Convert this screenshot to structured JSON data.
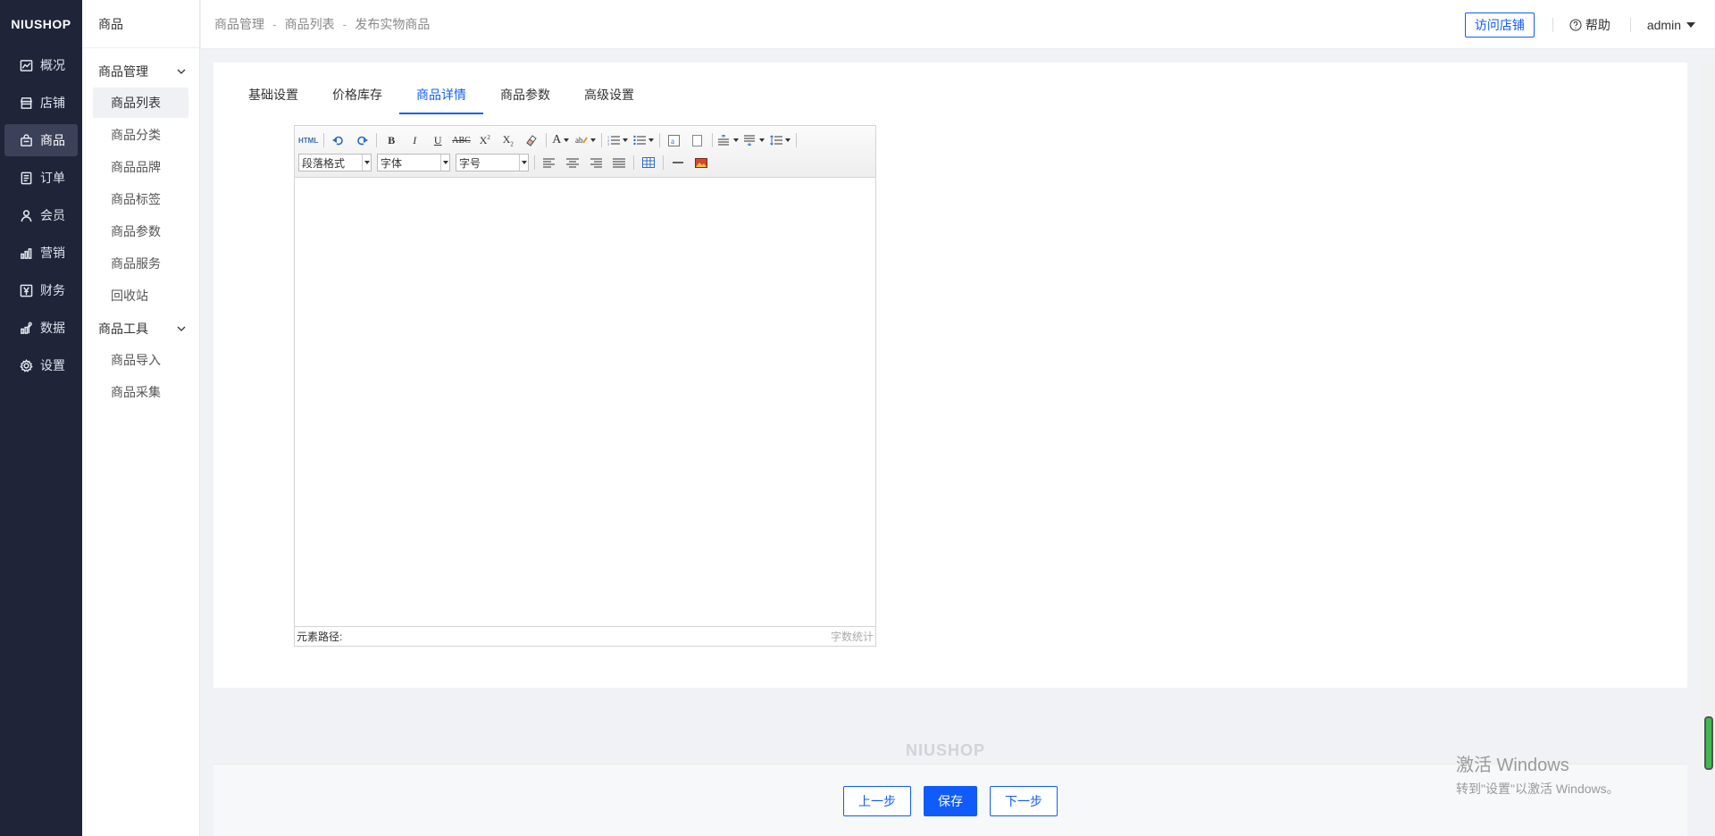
{
  "brand": "NIUSHOP",
  "main_nav": [
    {
      "label": "概况",
      "icon": "chart-line-icon",
      "active": false
    },
    {
      "label": "店铺",
      "icon": "store-icon",
      "active": false
    },
    {
      "label": "商品",
      "icon": "bag-icon",
      "active": true
    },
    {
      "label": "订单",
      "icon": "order-icon",
      "active": false
    },
    {
      "label": "会员",
      "icon": "user-icon",
      "active": false
    },
    {
      "label": "营销",
      "icon": "bar-chart-icon",
      "active": false
    },
    {
      "label": "财务",
      "icon": "yen-icon",
      "active": false
    },
    {
      "label": "数据",
      "icon": "data-icon",
      "active": false
    },
    {
      "label": "设置",
      "icon": "gear-icon",
      "active": false
    }
  ],
  "sub_nav": {
    "title": "商品",
    "groups": [
      {
        "label": "商品管理",
        "items": [
          "商品列表",
          "商品分类",
          "商品品牌",
          "商品标签",
          "商品参数",
          "商品服务",
          "回收站"
        ]
      },
      {
        "label": "商品工具",
        "items": [
          "商品导入",
          "商品采集"
        ]
      }
    ],
    "active_item": "商品列表"
  },
  "header": {
    "breadcrumb": [
      "商品管理",
      "商品列表",
      "发布实物商品"
    ],
    "separator": "-",
    "visit_store": "访问店铺",
    "help": "帮助",
    "user": "admin"
  },
  "tabs": [
    "基础设置",
    "价格库存",
    "商品详情",
    "商品参数",
    "高级设置"
  ],
  "active_tab": "商品详情",
  "editor": {
    "html_label": "HTML",
    "paragraph_select": "段落格式",
    "font_select": "字体",
    "size_select": "字号",
    "path_label": "元素路径:",
    "word_count": "字数统计"
  },
  "footer": {
    "logo": "NIUSHOP",
    "prev": "上一步",
    "save": "保存",
    "next": "下一步"
  },
  "windows_watermark": {
    "line1": "激活 Windows",
    "line2": "转到\"设置\"以激活 Windows。"
  },
  "colors": {
    "nav_bg": "#1f2438",
    "accent": "#105cfb"
  }
}
